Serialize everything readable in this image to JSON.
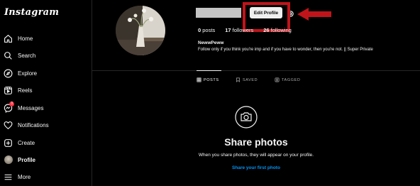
{
  "app": {
    "logo_text": "Instagram"
  },
  "sidebar": {
    "items": [
      {
        "label": "Home",
        "icon": "home-icon"
      },
      {
        "label": "Search",
        "icon": "search-icon"
      },
      {
        "label": "Explore",
        "icon": "compass-icon"
      },
      {
        "label": "Reels",
        "icon": "reels-icon"
      },
      {
        "label": "Messages",
        "icon": "messenger-icon",
        "badge": "3"
      },
      {
        "label": "Notifications",
        "icon": "heart-icon"
      },
      {
        "label": "Create",
        "icon": "plus-square-icon"
      },
      {
        "label": "Profile",
        "icon": "avatar"
      },
      {
        "label": "More",
        "icon": "hamburger-icon"
      }
    ]
  },
  "profile": {
    "edit_button": "Edit Profile",
    "stats": {
      "posts_count": "0",
      "posts_label": "posts",
      "followers_count": "17",
      "followers_label": "followers",
      "following_count": "26",
      "following_label": "following"
    },
    "display_name": "NewwPeww",
    "bio": "Follow only if you think you're imp and if you have to wonder, then you're not. || Super Private"
  },
  "tabs": [
    {
      "label": "POSTS",
      "icon": "grid-icon",
      "active": true
    },
    {
      "label": "SAVED",
      "icon": "bookmark-icon",
      "active": false
    },
    {
      "label": "TAGGED",
      "icon": "tag-icon",
      "active": false
    }
  ],
  "empty_state": {
    "icon": "camera-icon",
    "title": "Share photos",
    "subtitle": "When you share photos, they will appear on your profile.",
    "link": "Share your first photo"
  },
  "annotation": {
    "highlight_color": "#c0141b"
  }
}
